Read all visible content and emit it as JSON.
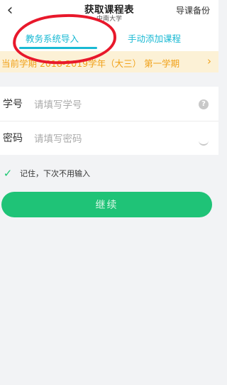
{
  "header": {
    "back_icon": "chevron-left-icon",
    "title": "获取课程表",
    "subtitle": "中南大学",
    "backup_label": "导课备份"
  },
  "tabs": {
    "items": [
      {
        "label": "教务系统导入",
        "active": true
      },
      {
        "label": "手动添加课程",
        "active": false
      }
    ],
    "accent_color": "#19b9d3"
  },
  "semester": {
    "text": "当前学期 2018-2019学年（大三） 第一学期",
    "chevron_icon": "chevron-right-icon"
  },
  "form": {
    "student_id": {
      "label": "学号",
      "placeholder": "请填写学号",
      "help_icon": "question-circle-icon"
    },
    "password": {
      "label": "密码",
      "placeholder": "请填写密码",
      "visibility_icon": "eye-closed-icon"
    }
  },
  "remember": {
    "checked": true,
    "label": "记住，下次不用输入",
    "check_icon": "check-icon"
  },
  "continue_button": {
    "label": "继续",
    "color": "#1fc377"
  },
  "annotation": {
    "color": "#e8182b"
  }
}
